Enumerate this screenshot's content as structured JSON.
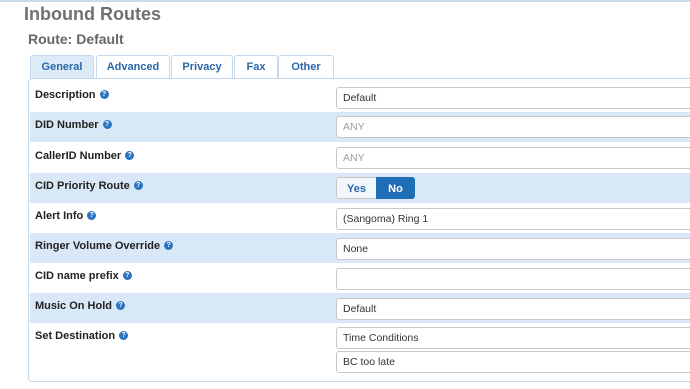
{
  "page": {
    "title": "Inbound Routes",
    "route_title": "Route: Default"
  },
  "tabs": [
    {
      "label": "General",
      "active": true
    },
    {
      "label": "Advanced",
      "active": false
    },
    {
      "label": "Privacy",
      "active": false
    },
    {
      "label": "Fax",
      "active": false
    },
    {
      "label": "Other",
      "active": false
    }
  ],
  "form": {
    "description": {
      "label": "Description",
      "value": "Default"
    },
    "did_number": {
      "label": "DID Number",
      "placeholder": "ANY"
    },
    "callerid_number": {
      "label": "CallerID Number",
      "placeholder": "ANY"
    },
    "cid_priority": {
      "label": "CID Priority Route",
      "yes": "Yes",
      "no": "No",
      "selected": "No"
    },
    "alert_info": {
      "label": "Alert Info",
      "value": "(Sangoma) Ring 1"
    },
    "ringer_volume": {
      "label": "Ringer Volume Override",
      "value": "None"
    },
    "cid_name_prefix": {
      "label": "CID name prefix",
      "value": ""
    },
    "music_on_hold": {
      "label": "Music On Hold",
      "value": "Default"
    },
    "set_destination": {
      "label": "Set Destination",
      "type_value": "Time Conditions",
      "target_value": "BC too late"
    }
  },
  "icons": {
    "help": "question-circle-icon"
  },
  "colors": {
    "accent": "#1f6db5",
    "row_shade": "#d8e8f6",
    "tab_text": "#2a66a8"
  }
}
